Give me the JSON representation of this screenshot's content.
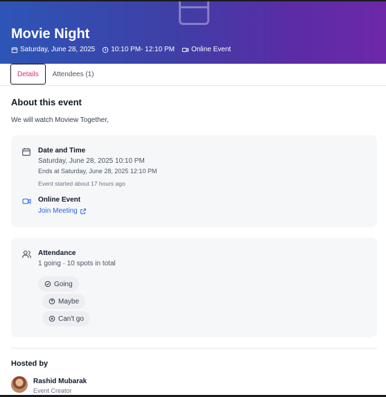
{
  "event": {
    "title": "Movie Night",
    "date": "Saturday, June 28, 2025",
    "time": "10:10 PM- 12:10 PM",
    "type": "Online Event"
  },
  "tabs": [
    {
      "label": "Details",
      "active": true
    },
    {
      "label": "Attendees (1)",
      "active": false
    }
  ],
  "about": {
    "title": "About this event",
    "description": "We will watch Moview Together,"
  },
  "datetime": {
    "label": "Date and Time",
    "start": "Saturday, June 28, 2025 10:10 PM",
    "end": "Ends at Saturday, June 28, 2025 12:10 PM",
    "status": "Event started about 17 hours ago"
  },
  "online": {
    "label": "Online Event",
    "link_label": "Join Meeting"
  },
  "attendance": {
    "label": "Attendance",
    "summary": "1 going · 10 spots in total",
    "options": [
      "Going",
      "Maybe",
      "Can't go"
    ]
  },
  "host": {
    "section_title": "Hosted by",
    "name": "Rashid Mubarak",
    "role": "Event Creator"
  },
  "colors": {
    "accent_tab": "#db2777",
    "link": "#2563eb",
    "header_start": "#2d55b6",
    "header_end": "#6d28a8"
  },
  "icons": [
    "calendar-icon",
    "clock-icon",
    "video-icon",
    "external-link-icon",
    "users-icon",
    "check-circle-icon",
    "help-circle-icon",
    "x-circle-icon"
  ]
}
